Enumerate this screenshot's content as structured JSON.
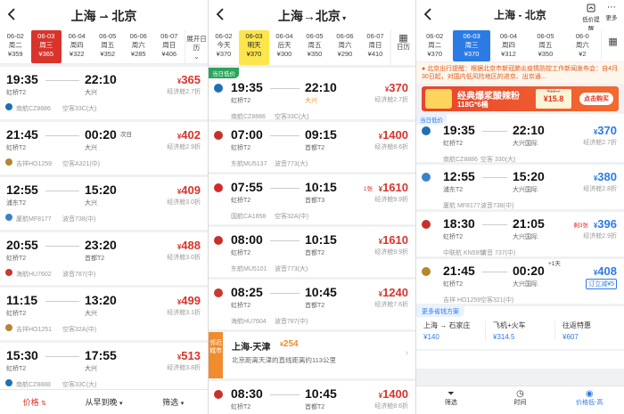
{
  "colors": {
    "red": "#d9342b",
    "blue": "#2c7be5",
    "orange": "#f08c2e",
    "green": "#2aa55b"
  },
  "p1": {
    "route_from": "上海",
    "route_to": "北京",
    "dates": [
      {
        "d": "06-02",
        "w": "周二",
        "p": "¥359"
      },
      {
        "d": "06-03",
        "w": "周三",
        "p": "¥365"
      },
      {
        "d": "06-04",
        "w": "周四",
        "p": "¥322"
      },
      {
        "d": "06-05",
        "w": "周五",
        "p": "¥352"
      },
      {
        "d": "06-06",
        "w": "周六",
        "p": "¥285"
      },
      {
        "d": "06-07",
        "w": "周日",
        "p": "¥406"
      }
    ],
    "expand_label": "展开日历",
    "flights": [
      {
        "dep": "19:35",
        "arr": "22:10",
        "from": "虹桥T2",
        "to": "大兴",
        "price": "365",
        "cabin": "经济舱2.7折",
        "airline": "南航CZ8886",
        "plane": "空客33C(大)",
        "logo": "#1f6fb6",
        "next": ""
      },
      {
        "dep": "21:45",
        "arr": "00:20",
        "from": "虹桥T2",
        "to": "大兴",
        "price": "402",
        "cabin": "经济舱2.9折",
        "airline": "吉祥HO1259",
        "plane": "空客A321(中)",
        "logo": "#b5862f",
        "next": "次日"
      },
      {
        "dep": "12:55",
        "arr": "15:20",
        "from": "浦东T2",
        "to": "大兴",
        "price": "409",
        "cabin": "经济舱3.0折",
        "airline": "厦航MF8177",
        "plane": "波音738(中)",
        "logo": "#3a83c9",
        "next": ""
      },
      {
        "dep": "20:55",
        "arr": "23:20",
        "from": "虹桥T2",
        "to": "首都T2",
        "price": "488",
        "cabin": "经济舱3.0折",
        "airline": "海航HU7602",
        "plane": "波音787(中)",
        "logo": "#c83a2e",
        "next": ""
      },
      {
        "dep": "11:15",
        "arr": "13:20",
        "from": "虹桥T2",
        "to": "大兴",
        "price": "499",
        "cabin": "经济舱3.1折",
        "airline": "吉祥HO1251",
        "plane": "空客32A(中)",
        "logo": "#b5862f",
        "next": ""
      },
      {
        "dep": "15:30",
        "arr": "17:55",
        "from": "虹桥T2",
        "to": "大兴",
        "price": "513",
        "cabin": "经济舱3.8折",
        "airline": "南航CZ8888",
        "plane": "空客33C(大)",
        "logo": "#1f6fb6",
        "next": ""
      }
    ],
    "bottom": [
      "价格",
      "从早到晚",
      "筛选"
    ]
  },
  "p2": {
    "route": "上海→北京",
    "dates": [
      {
        "d": "06-02",
        "w": "今天",
        "p": "¥370"
      },
      {
        "d": "06-03",
        "w": "明天",
        "p": "¥370"
      },
      {
        "d": "06-04",
        "w": "后天",
        "p": "¥300"
      },
      {
        "d": "06-05",
        "w": "周五",
        "p": "¥350"
      },
      {
        "d": "06-06",
        "w": "周六",
        "p": "¥290"
      },
      {
        "d": "06-07",
        "w": "周日",
        "p": "¥410"
      }
    ],
    "cal_label": "日历",
    "lowest_tag": "当日低价",
    "flights": [
      {
        "dep": "19:35",
        "arr": "22:10",
        "from": "虹桥T2",
        "to": "大兴",
        "price": "370",
        "cabin": "经济舱2.7折",
        "airline": "南航CZ8886",
        "plane": "空客33C(大)",
        "logo": "#1f6fb6",
        "tag": ""
      },
      {
        "dep": "07:00",
        "arr": "09:15",
        "from": "虹桥T2",
        "to": "首都T2",
        "price": "1400",
        "cabin": "经济舱8.6折",
        "airline": "东航MU5137",
        "plane": "波音773(大)",
        "logo": "#c8312a",
        "tag": ""
      },
      {
        "dep": "07:55",
        "arr": "10:15",
        "from": "虹桥T2",
        "to": "首都T3",
        "price": "1610",
        "cabin": "经济舱9.9折",
        "airline": "国航CA1858",
        "plane": "空客32A(中)",
        "logo": "#d12b2b",
        "tag": "1张"
      },
      {
        "dep": "08:00",
        "arr": "10:15",
        "from": "虹桥T2",
        "to": "首都T2",
        "price": "1610",
        "cabin": "经济舱9.9折",
        "airline": "东航MU5101",
        "plane": "波音773(大)",
        "logo": "#c8312a",
        "tag": ""
      },
      {
        "dep": "08:25",
        "arr": "10:45",
        "from": "虹桥T2",
        "to": "首都T2",
        "price": "1240",
        "cabin": "经济舱7.6折",
        "airline": "海航HU7604",
        "plane": "波音787(中)",
        "logo": "#c83a2e",
        "tag": ""
      }
    ],
    "nearby_tag": "邻近城市",
    "nearby_route": "上海-天津",
    "nearby_price": "254",
    "nearby_note": "北京距离天津的直线距离约113公里",
    "last": {
      "dep": "08:30",
      "arr": "10:45",
      "from": "虹桥T2",
      "to": "首都T2",
      "price": "1400",
      "cabin": "经济舱8.6折",
      "airline": "东航MU5151",
      "plane": "波音773(大)",
      "logo": "#c8312a"
    }
  },
  "p3": {
    "route": "上海 - 北京",
    "icons": [
      {
        "name": "price-alert",
        "label": "低价提醒"
      },
      {
        "name": "more",
        "label": "更多"
      }
    ],
    "dates": [
      {
        "d": "06-02",
        "w": "周二",
        "p": "¥370"
      },
      {
        "d": "06-03",
        "w": "周三",
        "p": "¥370"
      },
      {
        "d": "06-04",
        "w": "周四",
        "p": "¥312"
      },
      {
        "d": "06-05",
        "w": "周五",
        "p": "¥350"
      },
      {
        "d": "06-0",
        "w": "周六",
        "p": "¥2"
      }
    ],
    "notice": "北京出行提醒：根据北京市新冠肺炎疫情防控工作新闻发布会：自4月30日起，对国内低风险地区的进京、出京通...",
    "ad_text": "经典爆浆酸辣粉",
    "ad_sub": "118G*6桶",
    "ad_old": "¥18.7",
    "ad_price": "¥15.8",
    "ad_btn": "点击购买",
    "lowest_tag": "当日低价",
    "flights": [
      {
        "dep": "19:35",
        "arr": "22:10",
        "from": "虹桥T2",
        "to": "大兴国际",
        "price": "370",
        "cabin": "经济舱2.7折",
        "airline": "南航CZ8886",
        "plane": "空客 330(大)",
        "logo": "#1f6fb6",
        "tag": "",
        "next": ""
      },
      {
        "dep": "12:55",
        "arr": "15:20",
        "from": "浦东T2",
        "to": "大兴国际",
        "price": "380",
        "cabin": "经济舱2.8折",
        "airline": "厦航 MF8177",
        "plane": "波音738(中)",
        "logo": "#3a83c9",
        "tag": "",
        "next": ""
      },
      {
        "dep": "18:30",
        "arr": "21:05",
        "from": "虹桥T2",
        "to": "大兴国际",
        "price": "396",
        "cabin": "经济舱2.9折",
        "airline": "中联航 KN5956",
        "plane": "波音 737(中)",
        "logo": "#c8312a",
        "tag": "剩3张",
        "next": ""
      },
      {
        "dep": "21:45",
        "arr": "00:20",
        "from": "虹桥T2",
        "to": "大兴国际",
        "price": "408",
        "cabin": "订立减¥5",
        "airline": "吉祥 HO1259",
        "plane": "空客321(中)",
        "logo": "#b5862f",
        "tag": "",
        "next": "+1天"
      }
    ],
    "savings_title": "更多省钱方案",
    "savings": [
      {
        "t": "上海 → 石家庄",
        "p": "¥140"
      },
      {
        "t": "飞机+火车",
        "p": "¥314.5"
      },
      {
        "t": "往返特惠",
        "p": "¥607"
      }
    ],
    "bottom": [
      "筛选",
      "时间",
      "价格低-高"
    ]
  }
}
